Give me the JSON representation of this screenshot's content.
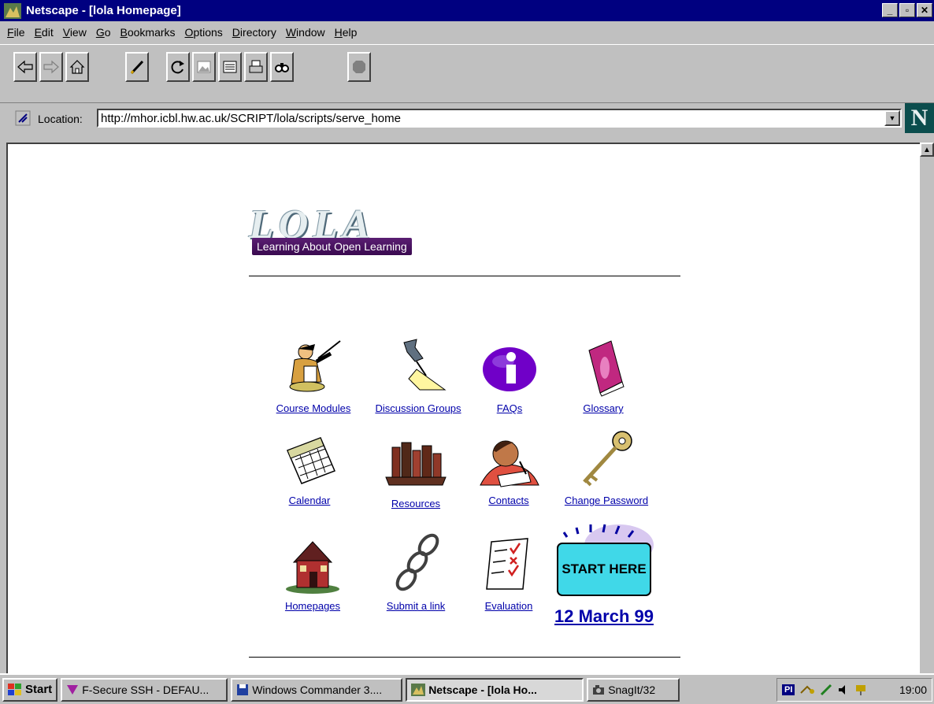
{
  "window": {
    "title": "Netscape - [lola Homepage]",
    "minimize": "_",
    "maximize": "▫",
    "close": "✕"
  },
  "menu": [
    "File",
    "Edit",
    "View",
    "Go",
    "Bookmarks",
    "Options",
    "Directory",
    "Window",
    "Help"
  ],
  "toolbar": {
    "buttons": [
      "back-icon",
      "forward-icon",
      "home-icon",
      "edit-icon",
      "reload-icon",
      "images-icon",
      "open-icon",
      "print-icon",
      "find-icon",
      "stop-icon"
    ]
  },
  "location": {
    "label": "Location:",
    "url": "http://mhor.icbl.hw.ac.uk/SCRIPT/lola/scripts/serve_home",
    "logo": "N"
  },
  "page": {
    "logo_word": "LOLA",
    "logo_tagline": "Learning About Open Learning",
    "links": [
      {
        "label": "Course Modules",
        "icon": "teacher-icon"
      },
      {
        "label": "Discussion Groups",
        "icon": "pushpin-icon"
      },
      {
        "label": "FAQs",
        "icon": "info-icon"
      },
      {
        "label": "Glossary",
        "icon": "book-icon"
      },
      {
        "label": "Calendar",
        "icon": "calendar-icon"
      },
      {
        "label": "Resources",
        "icon": "books-icon"
      },
      {
        "label": "Contacts",
        "icon": "person-writing-icon"
      },
      {
        "label": "Change Password",
        "icon": "key-icon"
      },
      {
        "label": "Homepages",
        "icon": "house-icon"
      },
      {
        "label": "Submit a link",
        "icon": "chain-icon"
      },
      {
        "label": "Evaluation",
        "icon": "checklist-icon"
      }
    ],
    "start_here": "START HERE",
    "date_link": "12 March 99"
  },
  "taskbar": {
    "start": "Start",
    "tasks": [
      {
        "label": "F-Secure SSH - DEFAU...",
        "active": false
      },
      {
        "label": "Windows Commander 3....",
        "active": false
      },
      {
        "label": "Netscape - [lola Ho...",
        "active": true
      },
      {
        "label": "SnagIt/32",
        "active": false
      }
    ],
    "tray_pl": "PI",
    "clock": "19:00"
  }
}
